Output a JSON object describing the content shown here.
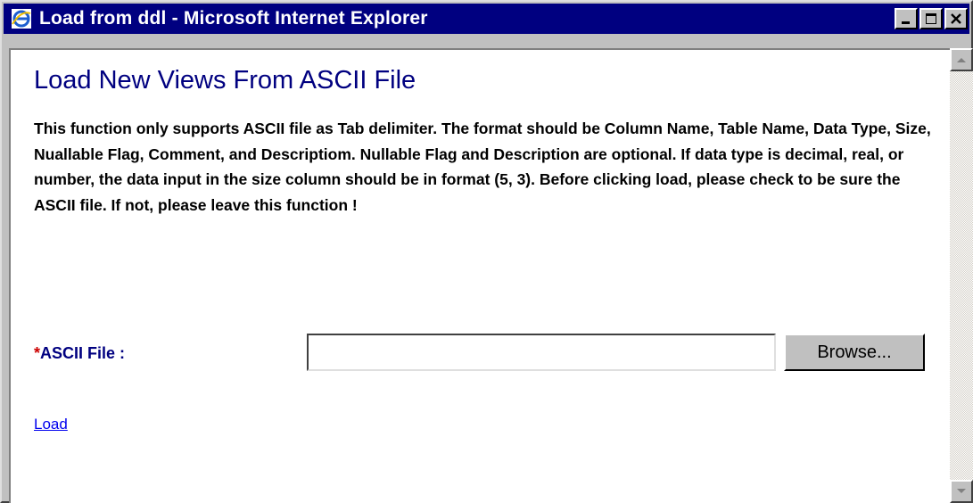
{
  "window": {
    "title": "Load from ddl - Microsoft Internet Explorer",
    "icon": "internet-explorer-icon",
    "controls": [
      "minimize-icon",
      "maximize-icon",
      "close-icon"
    ]
  },
  "page": {
    "heading": "Load New Views From ASCII File",
    "description": "This function only supports ASCII file as Tab delimiter. The format should be Column Name, Table Name, Data Type, Size, Nuallable Flag, Comment, and Descriptiom. Nullable Flag and Description are optional. If data type is decimal, real, or number, the data input in the size column should be in format (5, 3). Before clicking load, please check to be sure the ASCII file. If not, please leave this function !",
    "file_field": {
      "required_marker": "*",
      "label": "ASCII File :",
      "value": "",
      "browse_label": "Browse..."
    },
    "load_link": "Load"
  },
  "colors": {
    "titlebar": "#000080",
    "heading": "#000080",
    "required": "#cc0000",
    "link": "#0000ee"
  }
}
